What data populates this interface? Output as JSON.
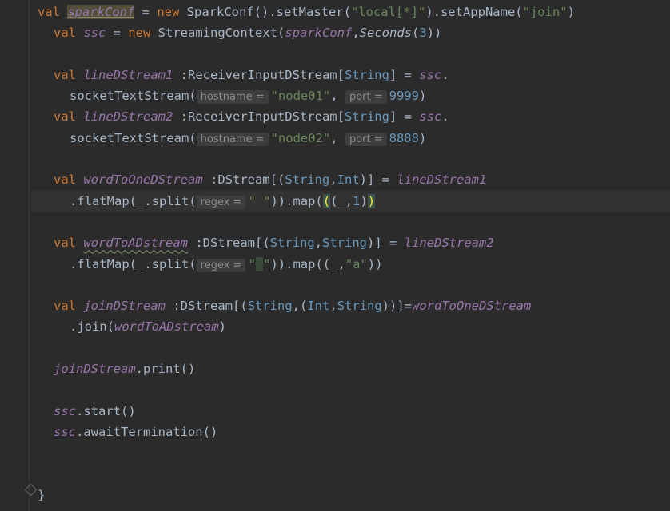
{
  "lines": {
    "l1": {
      "a": "val",
      "b": "sparkConf",
      "c": " = ",
      "d": "new",
      "e": " SparkConf().setMaster(",
      "f": "\"local[*]\"",
      "g": ").setAppName(",
      "h": "\"join\"",
      "i": ")"
    },
    "l2": {
      "a": "val",
      "b": "ssc",
      "c": " = ",
      "d": "new",
      "e": " StreamingContext(",
      "f": "sparkConf",
      "g": ",",
      "h": "Seconds",
      "i": "(",
      "j": "3",
      "k": "))"
    },
    "l3": {
      "a": "val",
      "b": "lineDStream1",
      "c": " :ReceiverInputDStream[",
      "d": "String",
      "e": "] = ",
      "f": "ssc",
      "g": "."
    },
    "l4": {
      "a": "socketTextStream(",
      "hint1": "hostname =",
      "b": "\"node01\"",
      "c": ", ",
      "hint2": "port =",
      "d": "9999",
      "e": ")"
    },
    "l5": {
      "a": "val",
      "b": "lineDStream2",
      "c": " :ReceiverInputDStream[",
      "d": "String",
      "e": "] = ",
      "f": "ssc",
      "g": "."
    },
    "l6": {
      "a": "socketTextStream(",
      "hint1": "hostname =",
      "b": "\"node02\"",
      "c": ", ",
      "hint2": "port =",
      "d": "8888",
      "e": ")"
    },
    "l7": {
      "a": "val",
      "b": "wordToOneDStream",
      "c": " :DStream[(",
      "d": "String",
      "e": ",",
      "f": "Int",
      "g": ")] = ",
      "h": "lineDStream1"
    },
    "l8": {
      "a": ".flatMap(_.split(",
      "hint": "regex =",
      "b": "\" \"",
      "c": ")).map(",
      "d": "(",
      "e": "(_,",
      "f": "1",
      "g": ")",
      "h": ")"
    },
    "l9": {
      "a": "val",
      "b": "wordToADstream",
      "c": " :DStream[(",
      "d": "String",
      "e": ",",
      "f": "String",
      "g": ")] = ",
      "h": "lineDStream2"
    },
    "l10": {
      "a": ".flatMap(_.split(",
      "hint": "regex =",
      "b": "\"",
      "b2": " ",
      "b3": "\"",
      "c": ")).map((_,",
      "d": "\"a\"",
      "e": "))"
    },
    "l11": {
      "a": "val",
      "b": "joinDStream",
      "c": " :DStream[(",
      "d": "String",
      "e": ",(",
      "f": "Int",
      "g": ",",
      "h": "String",
      "i": "))]=",
      "j": "wordToOneDStream"
    },
    "l12": {
      "a": ".join(",
      "b": "wordToADstream",
      "c": ")"
    },
    "l13": {
      "a": "joinDStream",
      "b": ".print()"
    },
    "l14": {
      "a": "ssc",
      "b": ".start()"
    },
    "l15": {
      "a": "ssc",
      "b": ".awaitTermination()"
    },
    "l16": {
      "a": "}"
    }
  },
  "icons": {
    "fold": "fold-marker-icon"
  },
  "colors": {
    "background": "#2b2b2b",
    "keyword": "#cc7832",
    "string": "#6a8759",
    "number": "#6897bb",
    "instance": "#9876aa",
    "text": "#a9b7c6"
  }
}
